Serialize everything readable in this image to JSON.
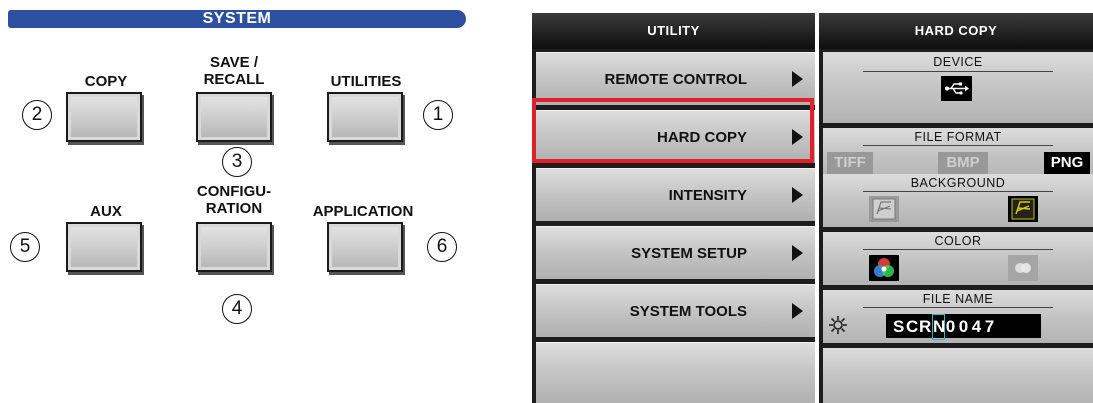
{
  "system_panel": {
    "title": "SYSTEM",
    "keys": {
      "copy": {
        "label": "COPY",
        "number": "2"
      },
      "save_recall": {
        "label_line1": "SAVE /",
        "label_line2": "RECALL",
        "number": "3"
      },
      "utilities": {
        "label": "UTILITIES",
        "number": "1"
      },
      "aux": {
        "label": "AUX",
        "number": "5"
      },
      "configuration": {
        "label_line1": "CONFIGU-",
        "label_line2": "RATION",
        "number": "4"
      },
      "application": {
        "label": "APPLICATION",
        "number": "6"
      }
    }
  },
  "utility_menu": {
    "title": "UTILITY",
    "items": [
      {
        "label": "REMOTE CONTROL"
      },
      {
        "label": "HARD COPY"
      },
      {
        "label": "INTENSITY"
      },
      {
        "label": "SYSTEM SETUP"
      },
      {
        "label": "SYSTEM TOOLS"
      }
    ],
    "highlight_color": "#e0202a"
  },
  "hard_copy_menu": {
    "title": "HARD COPY",
    "device": {
      "title": "DEVICE",
      "icon": "usb-icon"
    },
    "file_format": {
      "title": "FILE FORMAT",
      "options": [
        "TIFF",
        "BMP",
        "PNG"
      ],
      "selected": "PNG"
    },
    "background": {
      "title": "BACKGROUND",
      "options": [
        "white-background-icon",
        "black-background-icon"
      ],
      "selected": "black-background-icon"
    },
    "color": {
      "title": "COLOR",
      "options": [
        "color-icon",
        "grayscale-icon"
      ],
      "selected": "color-icon"
    },
    "file_name": {
      "title": "FILE NAME",
      "chars": [
        "S",
        "C",
        "R",
        "N",
        "0",
        "0",
        "4",
        "7"
      ],
      "cursor_index": 3,
      "icon": "settings-icon"
    },
    "accent_color": "#2fb5c8"
  }
}
